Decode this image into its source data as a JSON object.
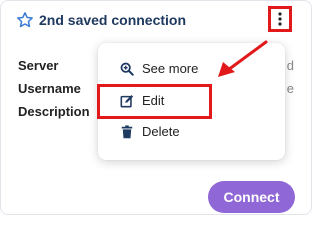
{
  "card": {
    "title": "2nd saved connection",
    "fields": [
      {
        "label": "Server",
        "value": "d"
      },
      {
        "label": "Username",
        "value": "e"
      },
      {
        "label": "Description",
        "value": ""
      }
    ],
    "connect_label": "Connect"
  },
  "menu": {
    "items": [
      {
        "label": "See more",
        "icon": "zoom-in-icon"
      },
      {
        "label": "Edit",
        "icon": "edit-icon"
      },
      {
        "label": "Delete",
        "icon": "trash-icon"
      }
    ]
  },
  "icons": {
    "favorite": "star-outline-icon",
    "more": "kebab-icon"
  },
  "colors": {
    "title": "#1f3a60",
    "star": "#3a7bd5",
    "menu_icon": "#1f3a60",
    "connect_button": "#8f67d6",
    "annotation": "#e2191b"
  }
}
